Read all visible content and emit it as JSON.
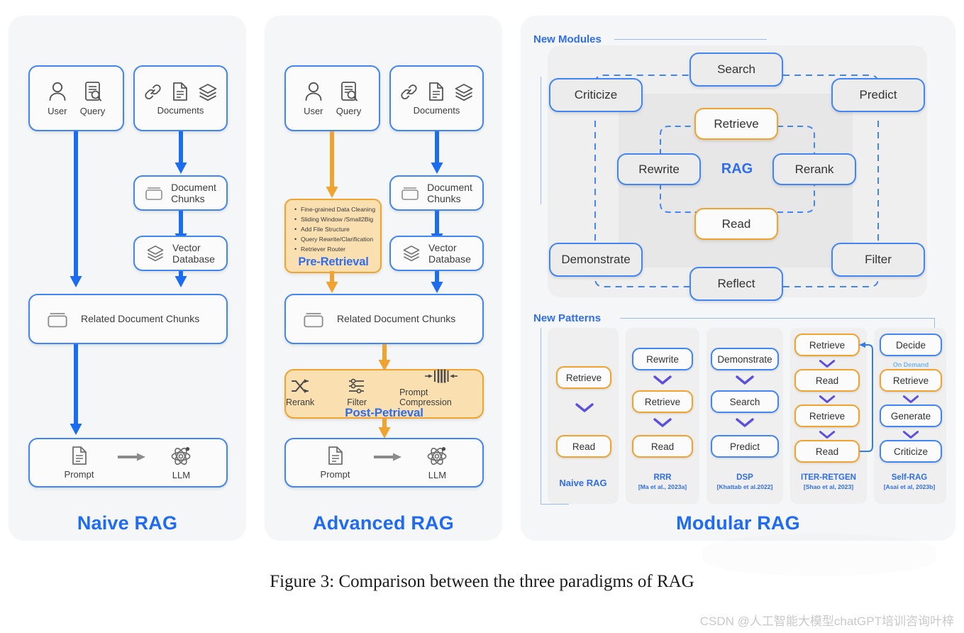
{
  "figure": {
    "caption": "Figure 3: Comparison between the three paradigms of RAG",
    "watermark": "CSDN @人工智能大模型chatGPT培训咨询叶梓"
  },
  "colors": {
    "blue": "#4285f4",
    "title_blue": "#1f6bf5",
    "orange": "#f0a32e",
    "orange_fill": "#fadfb0",
    "panel_bg": "#f5f6f7",
    "box_bg": "#fbfbfc",
    "module_bg": "#ececed",
    "light_blue": "#77b6ef"
  },
  "naive": {
    "title": "Naive RAG",
    "user_label": "User",
    "query_label": "Query",
    "documents_label": "Documents",
    "document_chunks": "Document\nChunks",
    "document_chunks_line1": "Document",
    "document_chunks_line2": "Chunks",
    "vector_database_line1": "Vector",
    "vector_database_line2": "Database",
    "related_chunks": "Related Document Chunks",
    "prompt_label": "Prompt",
    "llm_label": "LLM"
  },
  "advanced": {
    "title": "Advanced RAG",
    "user_label": "User",
    "query_label": "Query",
    "documents_label": "Documents",
    "document_chunks_line1": "Document",
    "document_chunks_line2": "Chunks",
    "vector_database_line1": "Vector",
    "vector_database_line2": "Database",
    "related_chunks": "Related Document Chunks",
    "prompt_label": "Prompt",
    "llm_label": "LLM",
    "pre_retrieval": {
      "stage_label": "Pre-Retrieval",
      "items": [
        "Fine-grained Data Cleaning",
        "Sliding Window /Small2Big",
        "Add File Structure",
        "Query Rewrite/Clarification",
        "Retriever Router"
      ]
    },
    "post_retrieval": {
      "stage_label": "Post-Petrieval",
      "items": [
        "Rerank",
        "Filter",
        "Prompt Compression"
      ]
    }
  },
  "modular": {
    "title": "Modular RAG",
    "new_modules_label": "New Modules",
    "new_patterns_label": "New Patterns",
    "center_label": "RAG",
    "outer_modules": [
      "Search",
      "Predict",
      "Filter",
      "Reflect",
      "Demonstrate",
      "Criticize"
    ],
    "inner_modules": [
      "Retrieve",
      "Rerank",
      "Read",
      "Rewrite"
    ],
    "patterns": [
      {
        "name": "Naive RAG",
        "citation": "",
        "steps": [
          {
            "label": "Retrieve",
            "style": "orange"
          },
          {
            "label": "Read",
            "style": "orange"
          }
        ]
      },
      {
        "name": "RRR",
        "citation": "[Ma et al., 2023a]",
        "steps": [
          {
            "label": "Rewrite",
            "style": "blue"
          },
          {
            "label": "Retrieve",
            "style": "orange"
          },
          {
            "label": "Read",
            "style": "orange"
          }
        ]
      },
      {
        "name": "DSP",
        "citation": "[Khattab et al.2022]",
        "steps": [
          {
            "label": "Demonstrate",
            "style": "blue"
          },
          {
            "label": "Search",
            "style": "blue"
          },
          {
            "label": "Predict",
            "style": "blue"
          }
        ]
      },
      {
        "name": "ITER-RETGEN",
        "citation": "[Shao et al, 2023]",
        "steps": [
          {
            "label": "Retrieve",
            "style": "orange"
          },
          {
            "label": "Read",
            "style": "orange"
          },
          {
            "label": "Retrieve",
            "style": "orange"
          },
          {
            "label": "Read",
            "style": "orange"
          }
        ]
      },
      {
        "name": "Self-RAG",
        "citation": "[Asai et al, 2023b]",
        "annotation": "On Demand",
        "steps": [
          {
            "label": "Decide",
            "style": "blue"
          },
          {
            "label": "Retrieve",
            "style": "orange"
          },
          {
            "label": "Generate",
            "style": "blue"
          },
          {
            "label": "Criticize",
            "style": "blue"
          }
        ]
      }
    ]
  }
}
